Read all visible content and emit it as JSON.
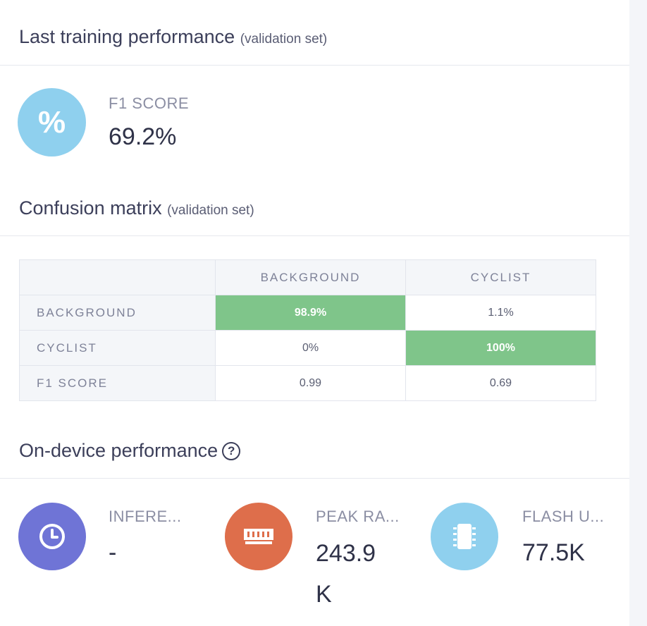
{
  "training": {
    "title": "Last training performance",
    "subtitle": "(validation set)",
    "f1": {
      "icon": "percent-icon",
      "label": "F1 SCORE",
      "value": "69.2%"
    }
  },
  "confusion": {
    "title": "Confusion matrix",
    "subtitle": "(validation set)",
    "columns": [
      "BACKGROUND",
      "CYCLIST"
    ],
    "rows": [
      {
        "label": "BACKGROUND",
        "cells": [
          "98.9%",
          "1.1%"
        ]
      },
      {
        "label": "CYCLIST",
        "cells": [
          "0%",
          "100%"
        ]
      },
      {
        "label": "F1 SCORE",
        "cells": [
          "0.99",
          "0.69"
        ]
      }
    ],
    "highlight_color": "#7fc58a"
  },
  "device": {
    "title": "On-device performance",
    "help_icon": "question-circle-icon",
    "metrics": [
      {
        "icon": "clock-icon",
        "label": "INFERE...",
        "value": "-",
        "color": "#6f74d6"
      },
      {
        "icon": "ram-icon",
        "label": "PEAK RA...",
        "value_line1": "243.9",
        "value_line2": "K",
        "color": "#de6e4b"
      },
      {
        "icon": "chip-icon",
        "label": "FLASH U...",
        "value": "77.5K",
        "color": "#8fd0ee"
      }
    ]
  }
}
